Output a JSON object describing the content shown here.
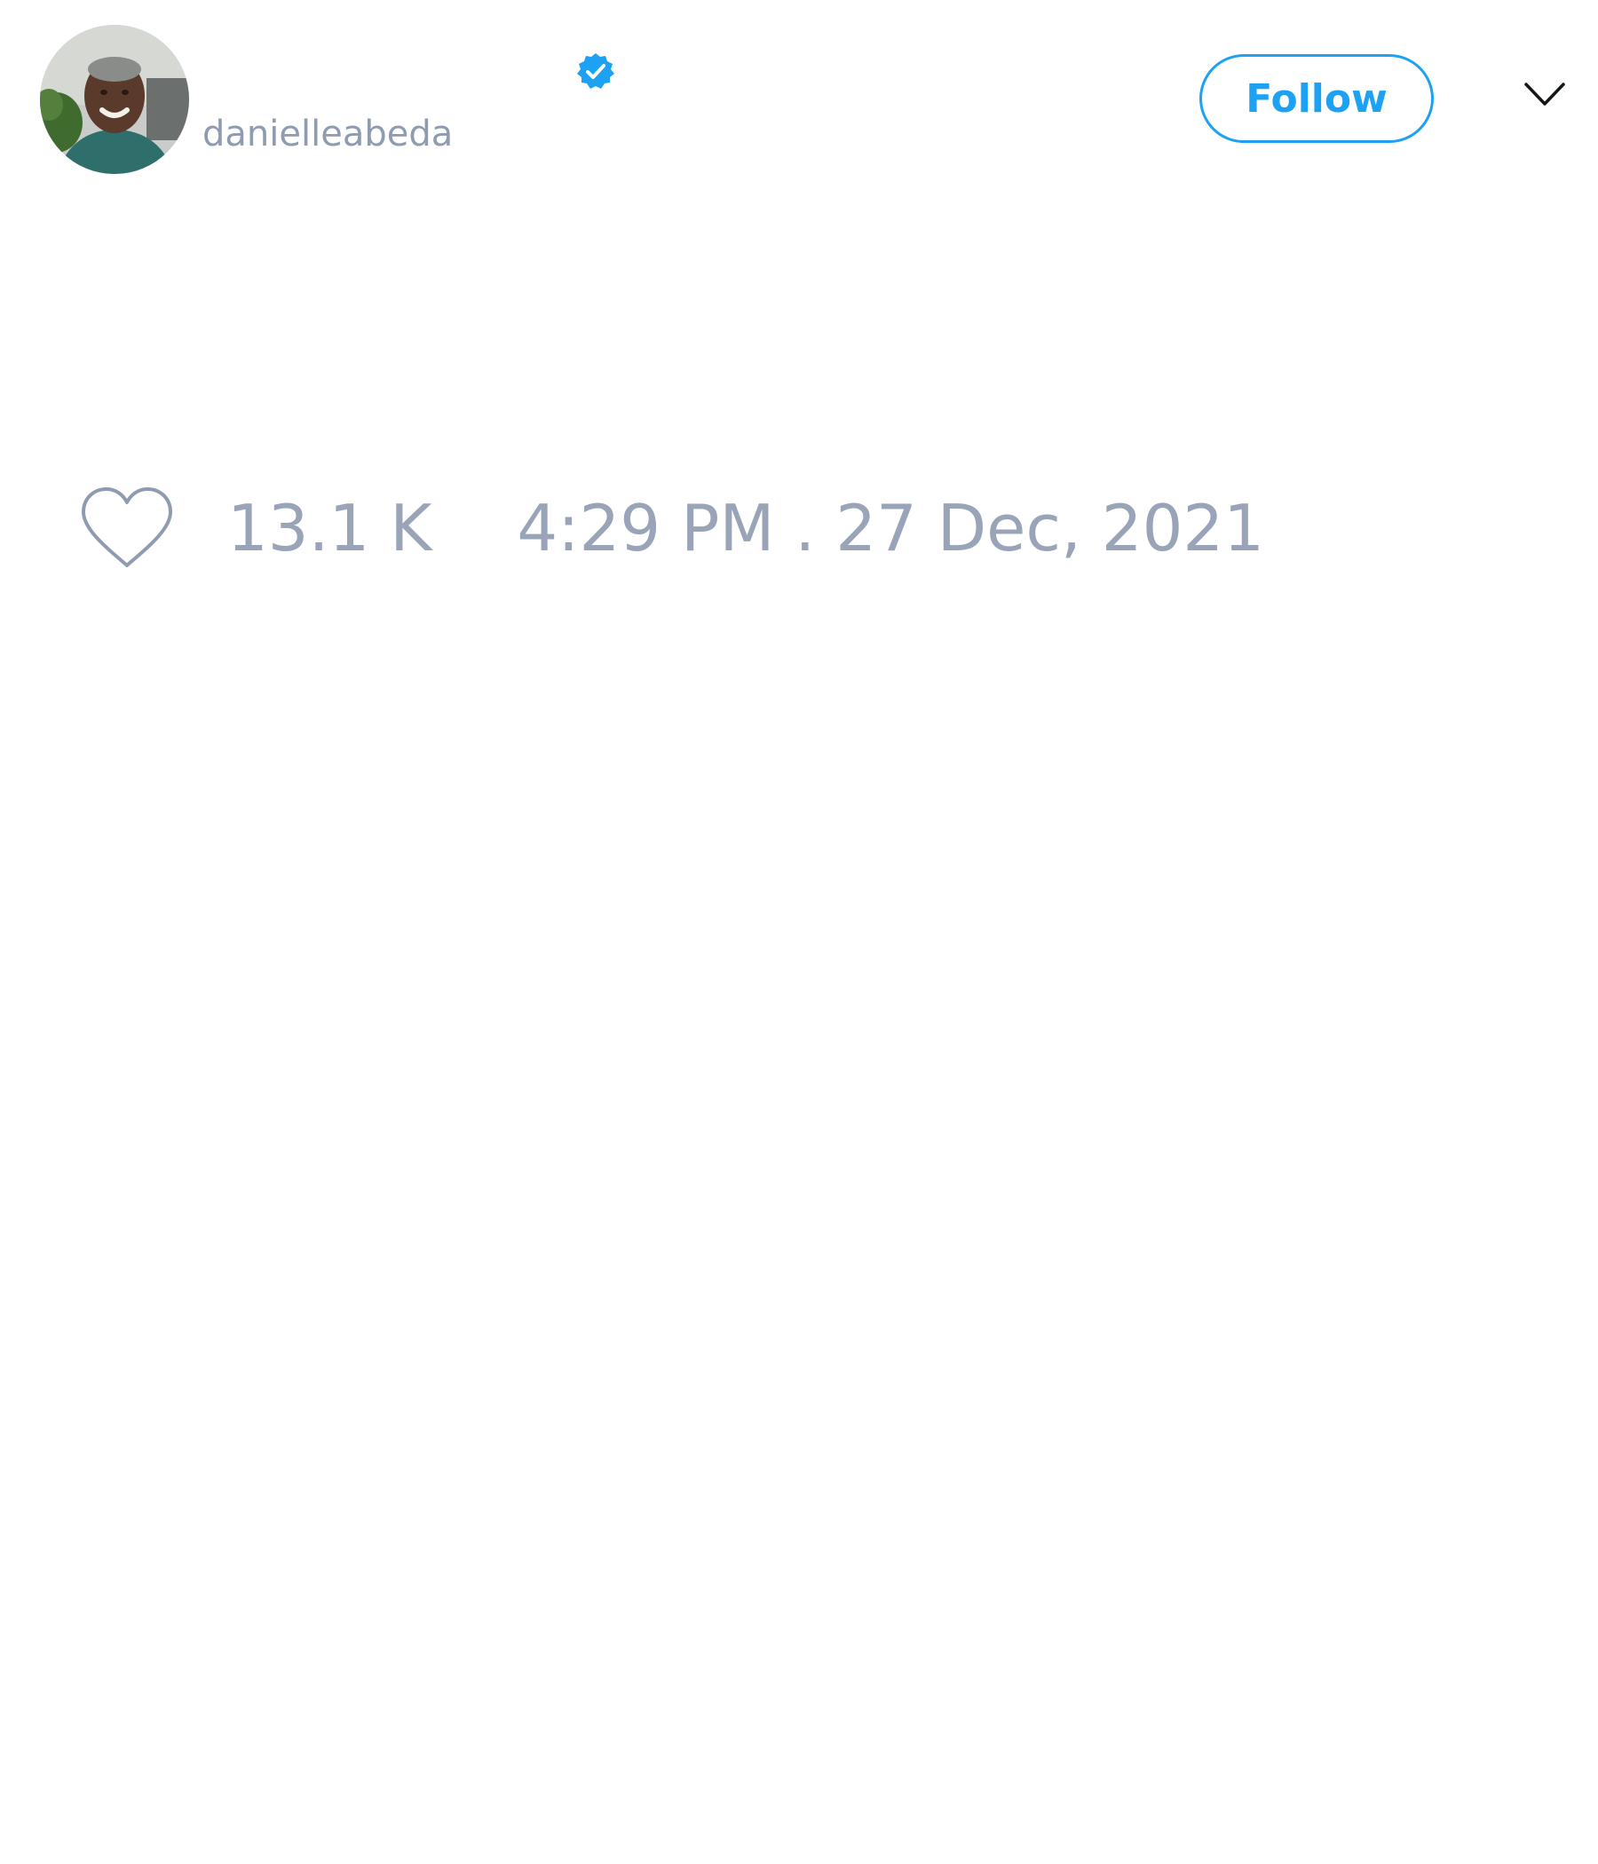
{
  "header": {
    "avatar_alt": "danielleabeda avatar",
    "display_name": "",
    "verified_icon": "verified-badge-icon",
    "handle": "danielleabeda",
    "follow_label": "Follow",
    "menu_icon": "chevron-down-icon"
  },
  "tweet": {
    "text": ""
  },
  "meta": {
    "like_icon": "heart-outline-icon",
    "like_count": "13.1 K",
    "timestamp": "4:29 PM . 27 Dec, 2021"
  },
  "colors": {
    "accent": "#1da1f2",
    "muted_text": "#99a4b8",
    "background": "#ffffff"
  }
}
